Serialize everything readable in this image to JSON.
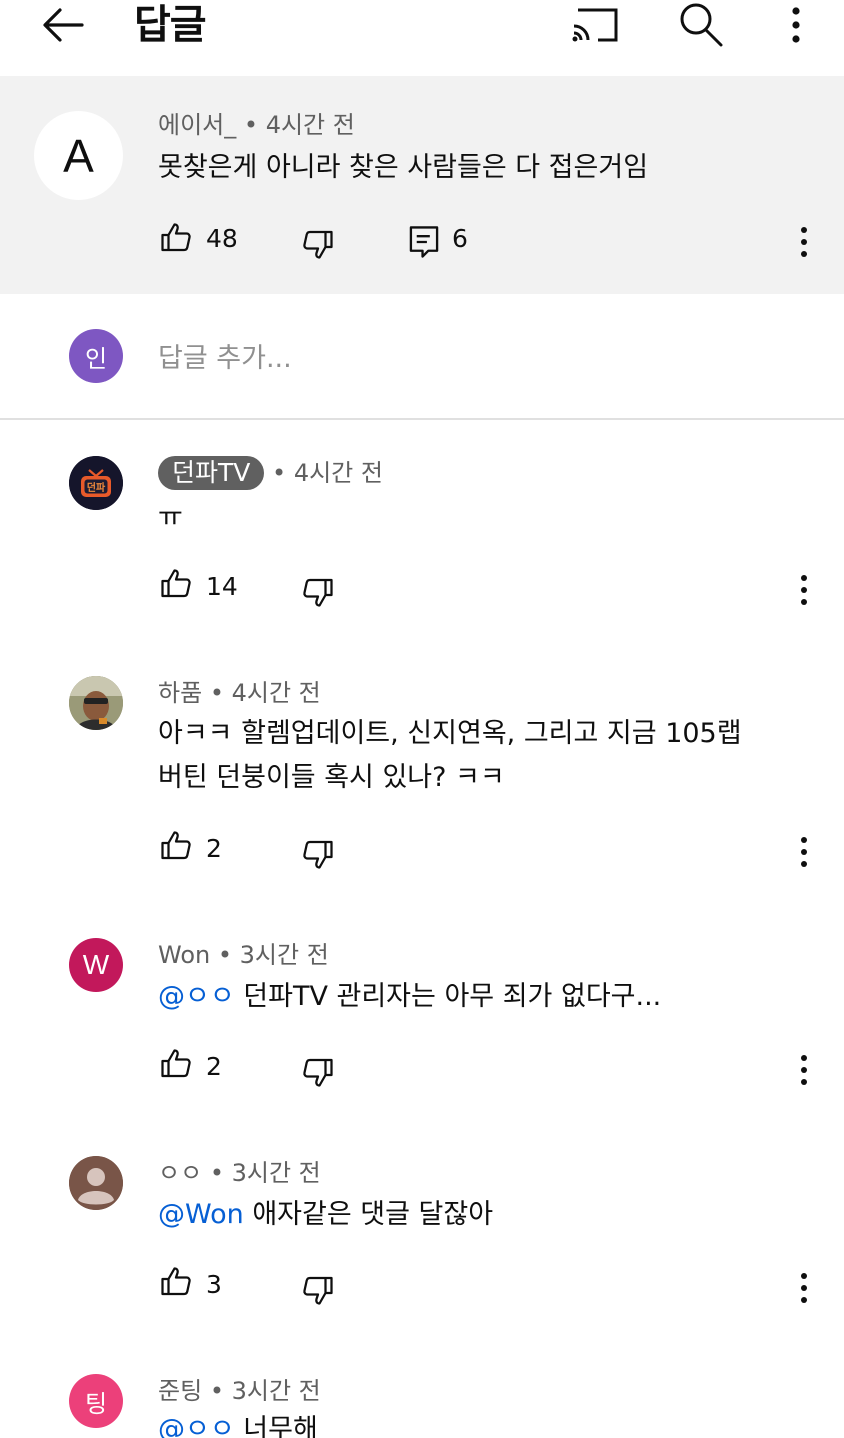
{
  "header": {
    "title": "답글",
    "back_icon": "arrow-left-icon",
    "cast_icon": "cast-icon",
    "search_icon": "search-icon",
    "more_icon": "more-vertical-icon"
  },
  "parent_comment": {
    "avatar_letter": "A",
    "author": "에이서_",
    "time": "4시간 전",
    "text": "못찾은게 아니라 찾은 사람들은 다 접은거임",
    "likes": "48",
    "replies": "6"
  },
  "add_reply": {
    "avatar_label": "인",
    "avatar_color": "#7e57c2",
    "placeholder": "답글 추가..."
  },
  "replies": [
    {
      "author": "던파TV",
      "time": "4시간 전",
      "text": "ㅠ",
      "likes": "14"
    },
    {
      "author": "하품",
      "time": "4시간 전",
      "text_line1": "아ㅋㅋ 할렘업데이트, 신지연옥, 그리고 지금 105랩",
      "text_line2": "버틴 던붕이들 혹시 있나? ㅋㅋ",
      "likes": "2"
    },
    {
      "avatar_letter": "W",
      "avatar_color": "#c2185b",
      "author": "Won",
      "time": "3시간 전",
      "mention": "@ㅇㅇ",
      "text": "던파TV 관리자는 아무 죄가 없다구...",
      "likes": "2"
    },
    {
      "author": "ㅇㅇ",
      "time": "3시간 전",
      "mention": "@Won",
      "text": "애자같은 댓글 달잖아",
      "likes": "3"
    },
    {
      "avatar_letter": "팅",
      "avatar_color": "#ec407a",
      "author": "준팅",
      "time": "3시간 전",
      "mention": "@ㅇㅇ",
      "text": "너무해"
    }
  ],
  "separator": "•",
  "icons": {
    "like": "thumb-up-icon",
    "dislike": "thumb-down-icon",
    "reply": "comment-icon",
    "action_menu": "more-vertical-icon"
  }
}
